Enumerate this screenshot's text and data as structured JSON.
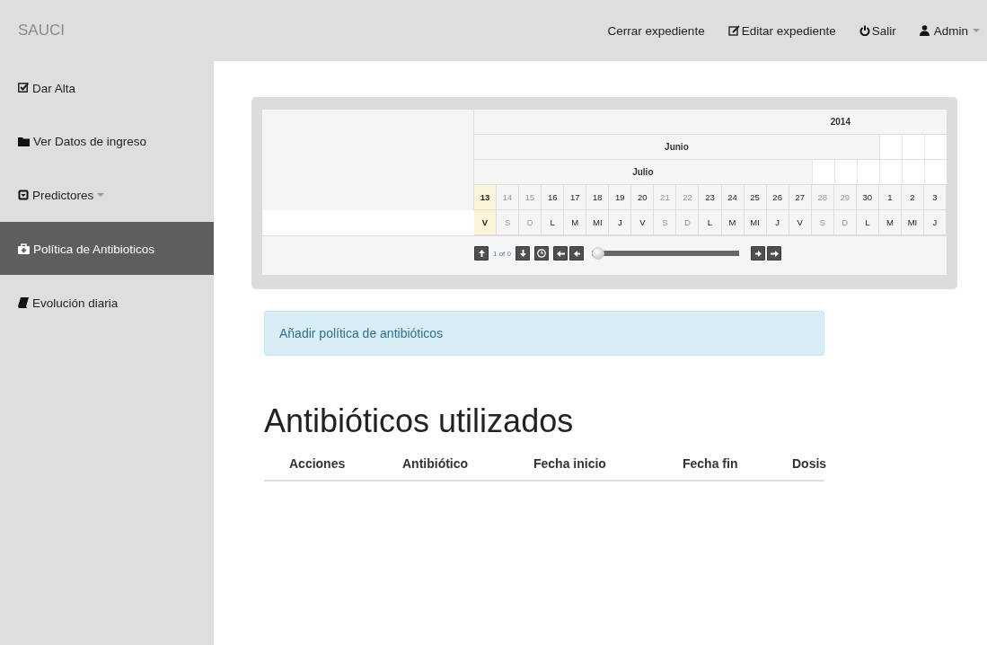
{
  "navbar": {
    "brand": "SAUCI",
    "links": [
      {
        "kind": "plain",
        "label": "Cerrar expediente"
      },
      {
        "kind": "edit",
        "label": "Editar expediente"
      },
      {
        "kind": "power",
        "label": "Salir"
      },
      {
        "kind": "user",
        "label": "Admin",
        "dropdown": true
      }
    ]
  },
  "sidebar": {
    "items": [
      {
        "kind": "check",
        "label": "Dar Alta",
        "selected": false,
        "dropdown": false
      },
      {
        "kind": "folder",
        "label": "Ver Datos de ingreso",
        "selected": false,
        "dropdown": false
      },
      {
        "kind": "box",
        "label": "Predictores",
        "selected": false,
        "dropdown": true
      },
      {
        "kind": "case",
        "label": "Política de Antibioticos",
        "selected": true,
        "dropdown": false
      },
      {
        "kind": "book",
        "label": "Evolución diaria",
        "selected": false,
        "dropdown": false
      }
    ]
  },
  "timeline": {
    "header_rows": [
      "2014",
      "Junio",
      "Julio"
    ],
    "days": [
      {
        "date": "13",
        "weekday": "V",
        "dim": false,
        "highlighted": true
      },
      {
        "date": "14",
        "weekday": "S",
        "dim": true,
        "highlighted": false
      },
      {
        "date": "15",
        "weekday": "D",
        "dim": true,
        "highlighted": false
      },
      {
        "date": "16",
        "weekday": "L",
        "dim": false,
        "highlighted": false
      },
      {
        "date": "17",
        "weekday": "M",
        "dim": false,
        "highlighted": false
      },
      {
        "date": "18",
        "weekday": "MI",
        "dim": false,
        "highlighted": false
      },
      {
        "date": "19",
        "weekday": "J",
        "dim": false,
        "highlighted": false
      },
      {
        "date": "20",
        "weekday": "V",
        "dim": false,
        "highlighted": false
      },
      {
        "date": "21",
        "weekday": "S",
        "dim": true,
        "highlighted": false
      },
      {
        "date": "22",
        "weekday": "D",
        "dim": true,
        "highlighted": false
      },
      {
        "date": "23",
        "weekday": "L",
        "dim": false,
        "highlighted": false
      },
      {
        "date": "24",
        "weekday": "M",
        "dim": false,
        "highlighted": false
      },
      {
        "date": "25",
        "weekday": "MI",
        "dim": false,
        "highlighted": false
      },
      {
        "date": "26",
        "weekday": "J",
        "dim": false,
        "highlighted": false
      },
      {
        "date": "27",
        "weekday": "V",
        "dim": false,
        "highlighted": false
      },
      {
        "date": "28",
        "weekday": "S",
        "dim": true,
        "highlighted": false
      },
      {
        "date": "29",
        "weekday": "D",
        "dim": true,
        "highlighted": false
      },
      {
        "date": "30",
        "weekday": "L",
        "dim": false,
        "highlighted": false
      },
      {
        "date": "1",
        "weekday": "M",
        "dim": false,
        "highlighted": false
      },
      {
        "date": "2",
        "weekday": "MI",
        "dim": false,
        "highlighted": false
      },
      {
        "date": "3",
        "weekday": "J",
        "dim": false,
        "highlighted": false
      }
    ],
    "pager": "1 of 0",
    "zoom": {
      "level": 0
    }
  },
  "alert": "Añadir política de antibióticos",
  "heading": "Antibióticos utilizados",
  "table": {
    "columns": [
      "Acciones",
      "Antibiótico",
      "Fecha inicio",
      "Fecha fin",
      "Dosis"
    ]
  }
}
